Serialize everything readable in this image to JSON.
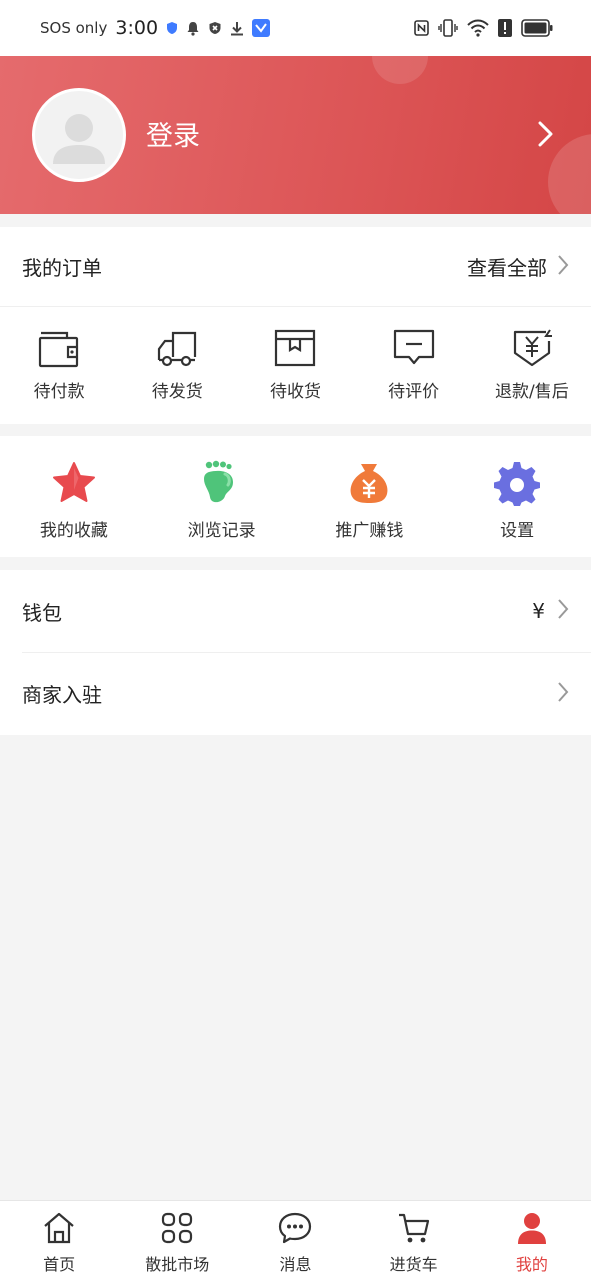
{
  "status_bar": {
    "carrier": "SOS only",
    "time": "3:00",
    "icons_left": [
      "shield-icon",
      "bell-icon",
      "block-icon",
      "download-icon",
      "app-notification-icon"
    ],
    "icons_right": [
      "nfc-icon",
      "vibrate-icon",
      "wifi-icon",
      "alert-icon",
      "battery-icon"
    ]
  },
  "header": {
    "login_label": "登录",
    "gradient_start": "#e56b6d",
    "gradient_end": "#d44646"
  },
  "orders": {
    "title": "我的订单",
    "view_all": "查看全部",
    "items": [
      {
        "label": "待付款",
        "icon": "wallet-icon"
      },
      {
        "label": "待发货",
        "icon": "truck-icon"
      },
      {
        "label": "待收货",
        "icon": "box-icon"
      },
      {
        "label": "待评价",
        "icon": "comment-icon"
      },
      {
        "label": "退款/售后",
        "icon": "refund-icon"
      }
    ]
  },
  "tools": [
    {
      "label": "我的收藏",
      "icon": "star-icon",
      "color": "#e84a4e"
    },
    {
      "label": "浏览记录",
      "icon": "footprint-icon",
      "color": "#4fc47a"
    },
    {
      "label": "推广赚钱",
      "icon": "money-bag-icon",
      "color": "#f07a3a"
    },
    {
      "label": "设置",
      "icon": "gear-icon",
      "color": "#6a6fe0"
    }
  ],
  "list": [
    {
      "label": "钱包",
      "value": "¥"
    },
    {
      "label": "商家入驻",
      "value": ""
    }
  ],
  "bottom_nav": [
    {
      "label": "首页",
      "icon": "home-icon",
      "active": false
    },
    {
      "label": "散批市场",
      "icon": "grid-icon",
      "active": false
    },
    {
      "label": "消息",
      "icon": "chat-icon",
      "active": false
    },
    {
      "label": "进货车",
      "icon": "cart-icon",
      "active": false
    },
    {
      "label": "我的",
      "icon": "person-icon",
      "active": true
    }
  ],
  "colors": {
    "accent": "#e0413f",
    "page_background": "#f4f4f4"
  }
}
